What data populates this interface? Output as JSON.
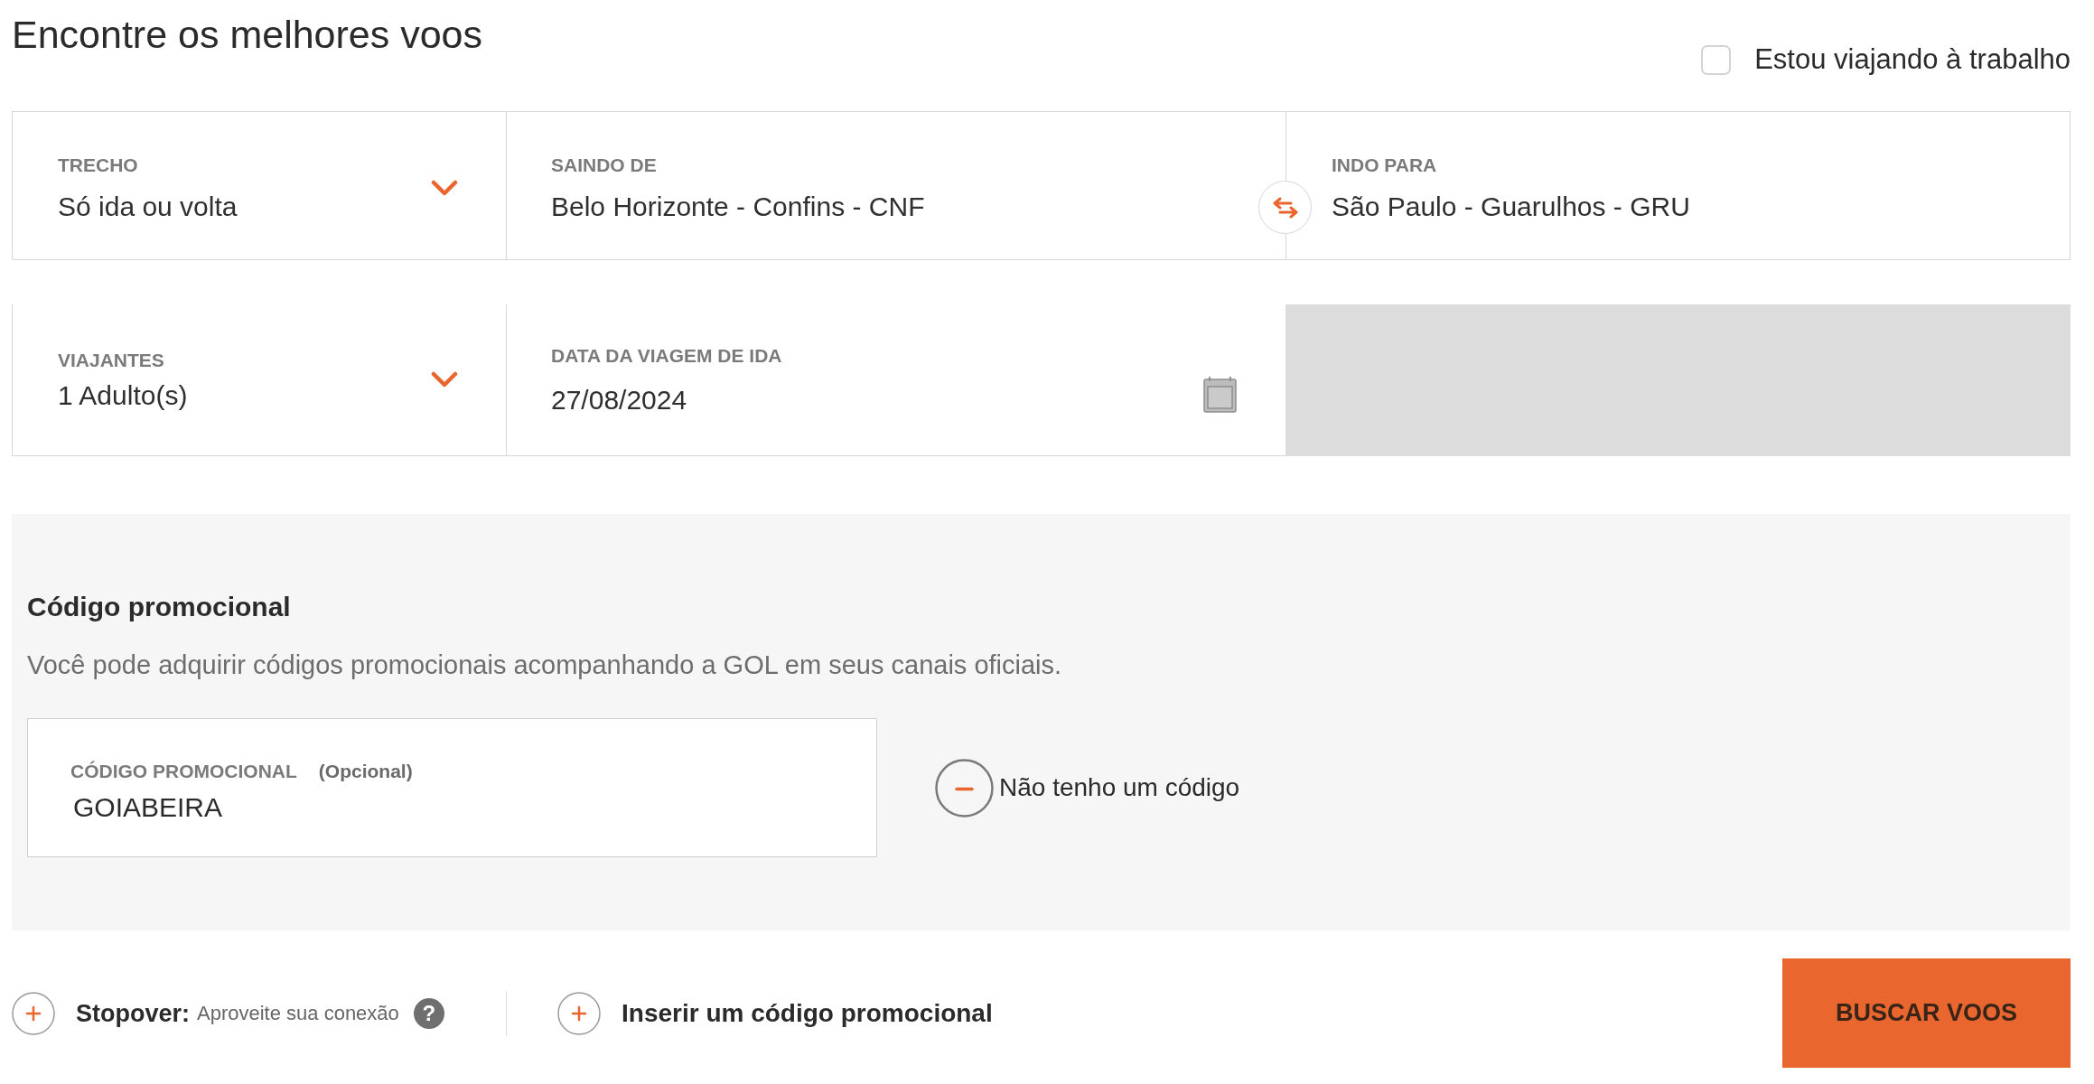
{
  "title": "Encontre os melhores voos",
  "business_travel": {
    "label": "Estou viajando à trabalho",
    "checked": false
  },
  "field_rows": [
    {
      "fields": [
        {
          "kind": "dropdown",
          "label": "TRECHO",
          "value": "Só ida ou volta"
        },
        {
          "kind": "location",
          "label": "SAINDO DE",
          "value": "Belo Horizonte - Confins - CNF"
        },
        {
          "kind": "location",
          "label": "INDO PARA",
          "value": "São Paulo - Guarulhos - GRU"
        }
      ]
    },
    {
      "fields": [
        {
          "kind": "dropdown",
          "label": "VIAJANTES",
          "value": "1 Adulto(s)"
        },
        {
          "kind": "date",
          "label": "DATA DA VIAGEM DE IDA",
          "value": "27/08/2024"
        },
        {
          "kind": "unavailable"
        }
      ]
    }
  ],
  "promo_code": {
    "heading": "Código promocional",
    "description": "Você pode adquirir códigos promocionais acompanhando a GOL em seus canais oficiais.",
    "field": {
      "label": "CÓDIGO PROMOCIONAL",
      "note": "(Opcional)",
      "value": "GOIABEIRA"
    },
    "dismiss": {
      "label": "Não tenho um código"
    }
  },
  "footer": {
    "stopover": {
      "label": "Stopover:",
      "detail": "Aproveite sua conexão",
      "help": "?"
    },
    "add_promo": {
      "label": "Inserir um código promocional"
    },
    "search_button": {
      "label": "BUSCAR VOOS"
    }
  }
}
